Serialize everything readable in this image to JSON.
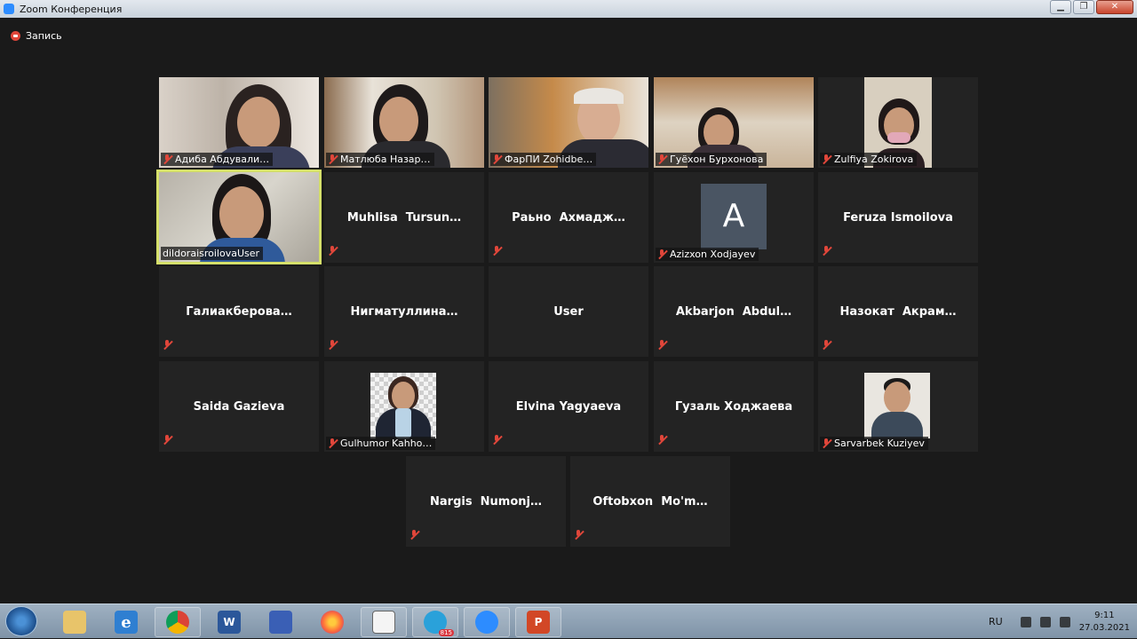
{
  "window": {
    "title": "Zoom Конференция"
  },
  "recording": {
    "label": "Запись"
  },
  "participants": [
    {
      "name": "Адиба Абдували…"
    },
    {
      "name": "Матлюба Назар…"
    },
    {
      "name": "ФарПИ Zohidbe…"
    },
    {
      "name": "Гуёхон Бурхонова"
    },
    {
      "name": "Zulfiya Zokirova"
    },
    {
      "name": "dildoraisroilovaUser"
    },
    {
      "name": "Muhlisa  Tursun…"
    },
    {
      "name": "Рaьно  Ахмадж…"
    },
    {
      "name": "Azizxon Xodjayev",
      "avatar_letter": "A"
    },
    {
      "name": "Feruza Ismoilova"
    },
    {
      "name": "Галиакберова…"
    },
    {
      "name": "Нигматуллина…"
    },
    {
      "name": "User"
    },
    {
      "name": "Akbarjon  Abdul…"
    },
    {
      "name": "Назокат  Акрам…"
    },
    {
      "name": "Saida Gazieva"
    },
    {
      "name": "Gulhumor Kahho…"
    },
    {
      "name": "Elvina Yagyaeva"
    },
    {
      "name": "Гузаль Ходжаева"
    },
    {
      "name": "Sarvarbek Kuziyev"
    },
    {
      "name": "Nargis  Numonj…"
    },
    {
      "name": "Oftobxon  Mo'm…"
    }
  ],
  "taskbar": {
    "apps": [
      {
        "name": "explorer",
        "glyph": ""
      },
      {
        "name": "internet-explorer",
        "glyph": "e"
      },
      {
        "name": "chrome",
        "glyph": ""
      },
      {
        "name": "word",
        "glyph": "W"
      },
      {
        "name": "save",
        "glyph": ""
      },
      {
        "name": "firefox",
        "glyph": ""
      },
      {
        "name": "document",
        "glyph": ""
      },
      {
        "name": "telegram",
        "glyph": "",
        "badge": "815"
      },
      {
        "name": "zoom",
        "glyph": ""
      },
      {
        "name": "powerpoint",
        "glyph": "P"
      }
    ],
    "language": "RU",
    "time": "9:11",
    "date": "27.03.2021"
  },
  "colors": {
    "background": "#1a1a1a",
    "tile": "#232323",
    "active_border": "#d5e06a",
    "muted_mic": "#e0463a"
  }
}
